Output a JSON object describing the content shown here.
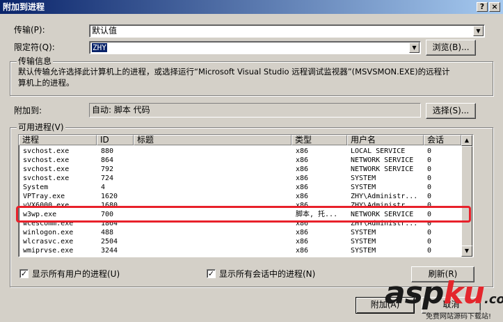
{
  "window": {
    "title": "附加到进程",
    "help_button": "?",
    "close_button": "×"
  },
  "transport": {
    "label": "传输(P):",
    "value": "默认值"
  },
  "qualifier": {
    "label": "限定符(Q):",
    "value": "ZHY",
    "browse_button": "浏览(B)..."
  },
  "transport_info": {
    "title": "传输信息",
    "text_line1": "默认传输允许选择此计算机上的进程，或选择运行“Microsoft Visual Studio 远程调试监视器”(MSVSMON.EXE)的远程计",
    "text_line2": "算机上的进程。"
  },
  "attach_to": {
    "label": "附加到:",
    "value": "自动: 脚本 代码",
    "select_button": "选择(S)..."
  },
  "processes": {
    "title": "可用进程(V)",
    "columns": [
      "进程",
      "ID",
      "标题",
      "类型",
      "用户名",
      "会话"
    ],
    "rows": [
      [
        "svchost.exe",
        "880",
        "",
        "x86",
        "LOCAL SERVICE",
        "0"
      ],
      [
        "svchost.exe",
        "864",
        "",
        "x86",
        "NETWORK SERVICE",
        "0"
      ],
      [
        "svchost.exe",
        "792",
        "",
        "x86",
        "NETWORK SERVICE",
        "0"
      ],
      [
        "svchost.exe",
        "724",
        "",
        "x86",
        "SYSTEM",
        "0"
      ],
      [
        "System",
        "4",
        "",
        "x86",
        "SYSTEM",
        "0"
      ],
      [
        "VPTray.exe",
        "1620",
        "",
        "x86",
        "ZHY\\Administr...",
        "0"
      ],
      [
        "vVX6000.exe",
        "1680",
        "",
        "x86",
        "ZHY\\Administr...",
        "0"
      ],
      [
        "w3wp.exe",
        "700",
        "",
        "脚本, 托...",
        "NETWORK SERVICE",
        "0"
      ],
      [
        "wcescomm.exe",
        "1864",
        "",
        "x86",
        "ZHY\\Administr...",
        "0"
      ],
      [
        "winlogon.exe",
        "488",
        "",
        "x86",
        "SYSTEM",
        "0"
      ],
      [
        "wlcrasvc.exe",
        "2504",
        "",
        "x86",
        "SYSTEM",
        "0"
      ],
      [
        "wmiprvse.exe",
        "3244",
        "",
        "x86",
        "SYSTEM",
        "0"
      ]
    ],
    "show_all_users": "显示所有用户的进程(U)",
    "show_all_sessions": "显示所有会话中的进程(N)",
    "refresh_button": "刷新(R)"
  },
  "footer": {
    "attach_button": "附加(A)",
    "cancel_button": "取消"
  },
  "watermark": {
    "logo": "aspku",
    "logo_suffix": ".com",
    "tagline": "免费网站源码下载站!"
  },
  "colors": {
    "titlebar": "#0a246a",
    "highlight": "#e8202a",
    "watermark_red": "#e4262c",
    "watermark_dark": "#1a1a1a"
  }
}
